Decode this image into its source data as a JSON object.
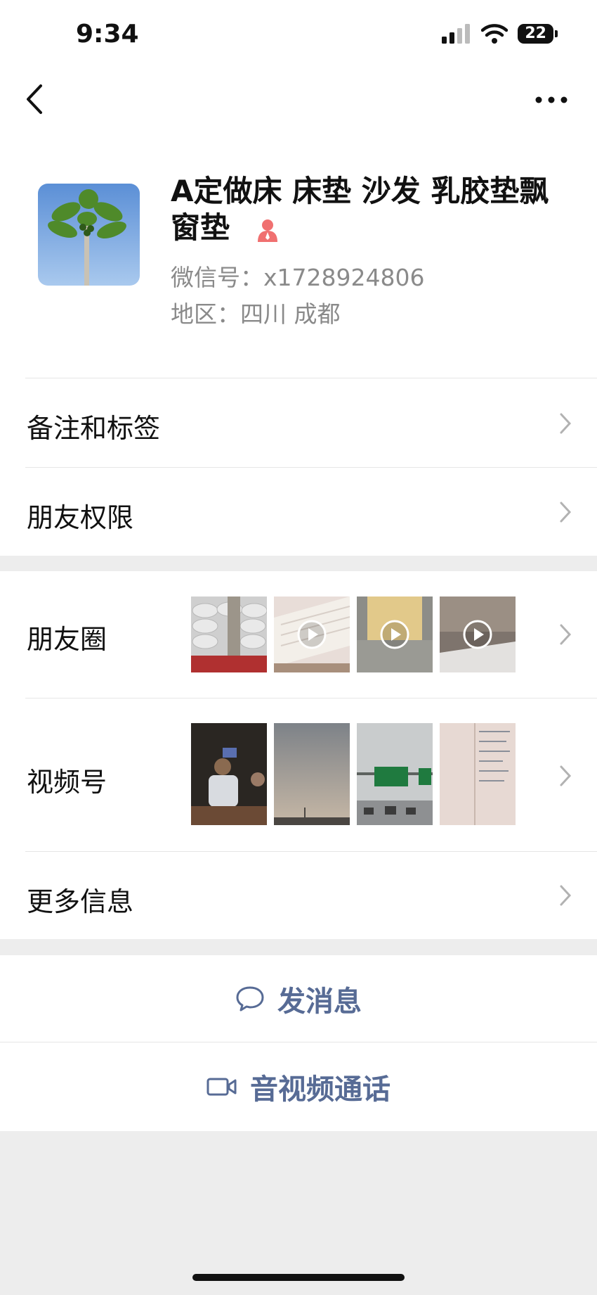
{
  "status": {
    "time": "9:34",
    "battery": "22"
  },
  "profile": {
    "name": "A定做床 床垫 沙发 乳胶垫飘窗垫",
    "wechat_id": "微信号：x1728924806",
    "region": "地区：四川 成都",
    "avatar_icon": "papaya-tree-photo",
    "gender_icon": "female-icon"
  },
  "menu": {
    "remarks_tags": "备注和标签",
    "friend_permissions": "朋友权限",
    "moments": "朋友圈",
    "channels": "视频号",
    "more_info": "更多信息"
  },
  "moments_thumbs": [
    {
      "name": "moments-thumb-sacks",
      "video": false
    },
    {
      "name": "moments-thumb-mattress",
      "video": true
    },
    {
      "name": "moments-thumb-foam",
      "video": true
    },
    {
      "name": "moments-thumb-room",
      "video": true
    }
  ],
  "channels_thumbs": [
    {
      "name": "channels-thumb-man"
    },
    {
      "name": "channels-thumb-sky"
    },
    {
      "name": "channels-thumb-highway"
    },
    {
      "name": "channels-thumb-notebook"
    }
  ],
  "actions": {
    "send_message": "发消息",
    "av_call": "音视频通话"
  },
  "colors": {
    "link": "#576b95",
    "gender": "#f07070",
    "background": "#ededed"
  }
}
